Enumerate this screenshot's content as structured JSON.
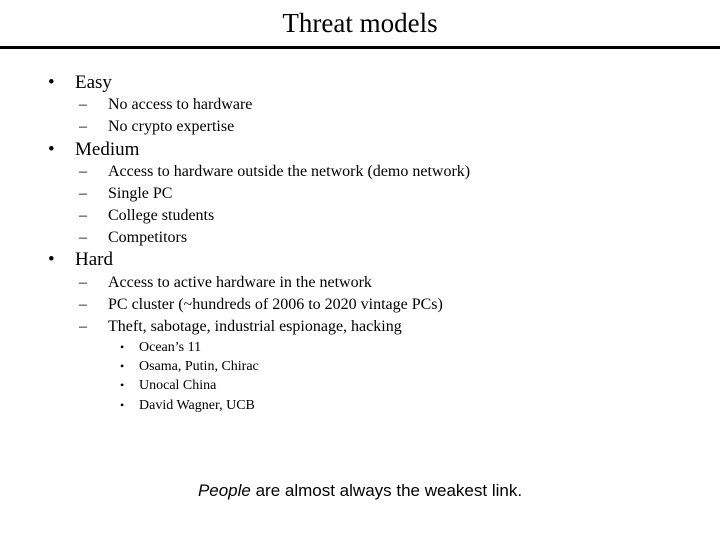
{
  "slide": {
    "title": "Threat models",
    "sections": [
      {
        "label": "Easy",
        "items": [
          "No access to hardware",
          "No crypto expertise"
        ]
      },
      {
        "label": "Medium",
        "items": [
          "Access to hardware outside the network (demo network)",
          "Single PC",
          "College students",
          "Competitors"
        ]
      },
      {
        "label": "Hard",
        "items": [
          "Access to active hardware in the network",
          "PC cluster (~hundreds of 2006 to 2020 vintage PCs)",
          "Theft, sabotage, industrial espionage, hacking"
        ],
        "subitems": [
          "Ocean’s 11",
          "Osama, Putin, Chirac",
          "Unocal China",
          "David Wagner, UCB"
        ]
      }
    ],
    "footer": {
      "emphasis": "People",
      "rest": " are almost always the weakest link."
    },
    "bullet_glyph": "•",
    "dash_glyph": "–"
  }
}
